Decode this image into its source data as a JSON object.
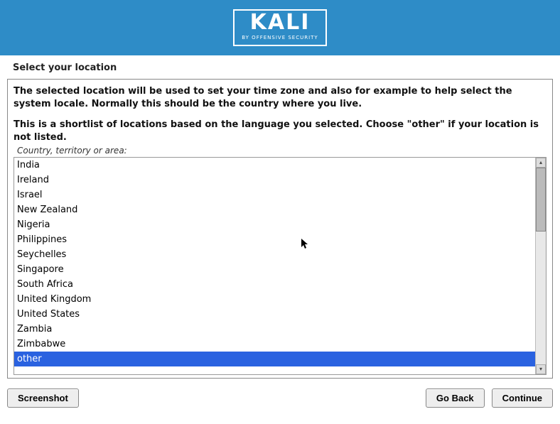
{
  "header": {
    "logo_text": "KALI",
    "logo_sub": "BY OFFENSIVE SECURITY"
  },
  "title": "Select your location",
  "instructions_line1": "The selected location will be used to set your time zone and also for example to help select the system locale. Normally this should be the country where you live.",
  "instructions_line2": "This is a shortlist of locations based on the language you selected. Choose \"other\" if your location is not listed.",
  "list_label": "Country, territory or area:",
  "locations": {
    "items": [
      "India",
      "Ireland",
      "Israel",
      "New Zealand",
      "Nigeria",
      "Philippines",
      "Seychelles",
      "Singapore",
      "South Africa",
      "United Kingdom",
      "United States",
      "Zambia",
      "Zimbabwe",
      "other"
    ],
    "selected_index": 13
  },
  "buttons": {
    "screenshot": "Screenshot",
    "go_back": "Go Back",
    "continue": "Continue"
  }
}
